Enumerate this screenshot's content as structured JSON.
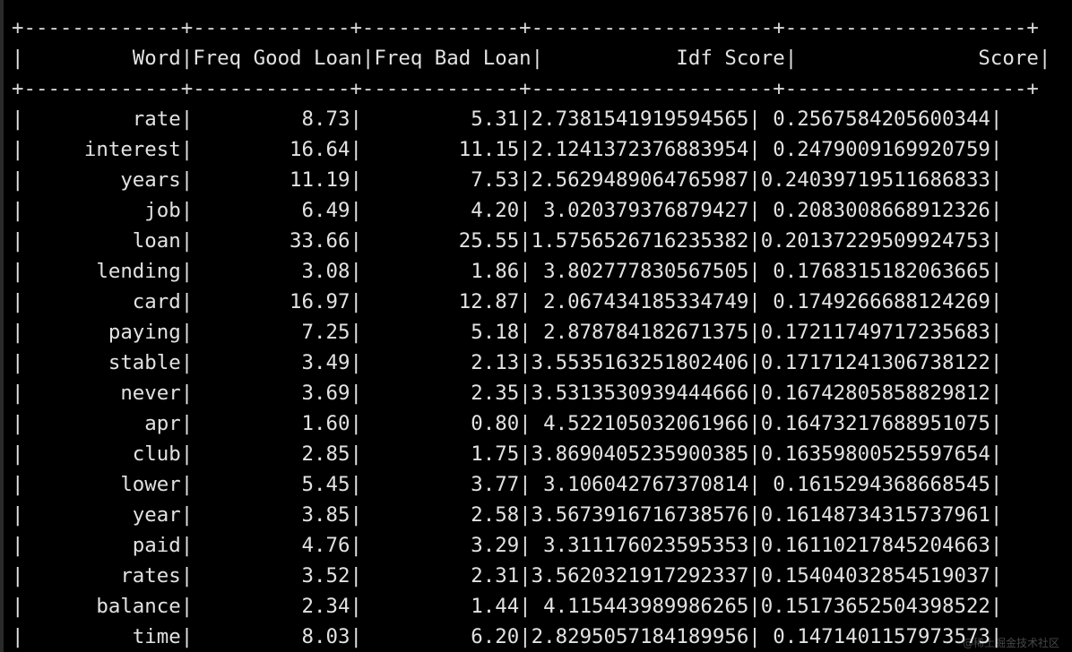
{
  "terminal": {
    "border_top": "+-------------+-------------+-------------+--------------------+--------------------+",
    "header": "|         Word|Freq Good Loan|Freq Bad Loan|           Idf Score|               Score|",
    "border_mid": "+-------------+-------------+-------------+--------------------+--------------------+",
    "rows": [
      "|         rate|         8.73|         5.31|2.7381541919594565| 0.2567584205600344|",
      "|     interest|        16.64|        11.15|2.1241372376883954| 0.2479009169920759|",
      "|        years|        11.19|         7.53|2.5629489064765987|0.24039719511686833|",
      "|          job|         6.49|         4.20| 3.020379376879427| 0.2083008668912326|",
      "|         loan|        33.66|        25.55|1.5756526716235382|0.20137229509924753|",
      "|      lending|         3.08|         1.86| 3.802777830567505| 0.1768315182063665|",
      "|         card|        16.97|        12.87| 2.067434185334749| 0.1749266688124269|",
      "|       paying|         7.25|         5.18| 2.878784182671375|0.17211749717235683|",
      "|       stable|         3.49|         2.13|3.5535163251802406|0.17171241306738122|",
      "|        never|         3.69|         2.35|3.5313530939444666|0.16742805858829812|",
      "|          apr|         1.60|         0.80| 4.522105032061966|0.16473217688951075|",
      "|         club|         2.85|         1.75|3.8690405235900385|0.16359800525597654|",
      "|        lower|         5.45|         3.77| 3.106042767370814| 0.1615294368668545|",
      "|         year|         3.85|         2.58|3.5673916716738576|0.16148734315737961|",
      "|         paid|         4.76|         3.29| 3.311176023595353|0.16110217845204663|",
      "|        rates|         3.52|         2.31|3.5620321917292337|0.15404032854519037|",
      "|      balance|         2.34|         1.44| 4.115443989986265|0.15173652504398522|",
      "|         time|         8.03|         6.20|2.8295057184189956| 0.1471401157973573|"
    ]
  },
  "watermark": "@稀土掘金技术社区"
}
